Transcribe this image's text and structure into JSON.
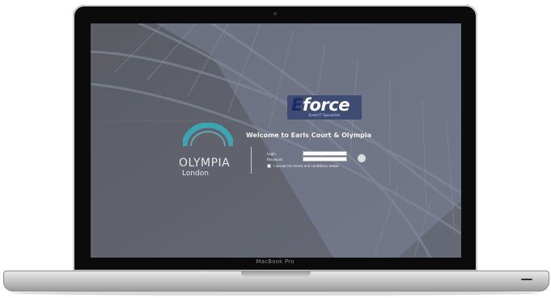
{
  "device": {
    "brand_label": "MacBook Pro"
  },
  "screen": {
    "logo": {
      "text_prefix": "E",
      "text_rest": "force",
      "subtitle": "Event IT Specialists"
    },
    "welcome": "Welcome to Earls Court & Olympia",
    "venue": {
      "name": "OLYMPIA",
      "city": "London"
    },
    "form": {
      "login_label": "Login",
      "password_label": "Password",
      "login_value": "",
      "password_value": "",
      "accept_label": "I accept the terms and conditions below",
      "accepted": false,
      "submit_icon": "go-icon"
    }
  },
  "colors": {
    "screen_overlay": "#6f7076",
    "logo_bg": "#3e4b72",
    "arc_teal": "#3aa6b4"
  }
}
